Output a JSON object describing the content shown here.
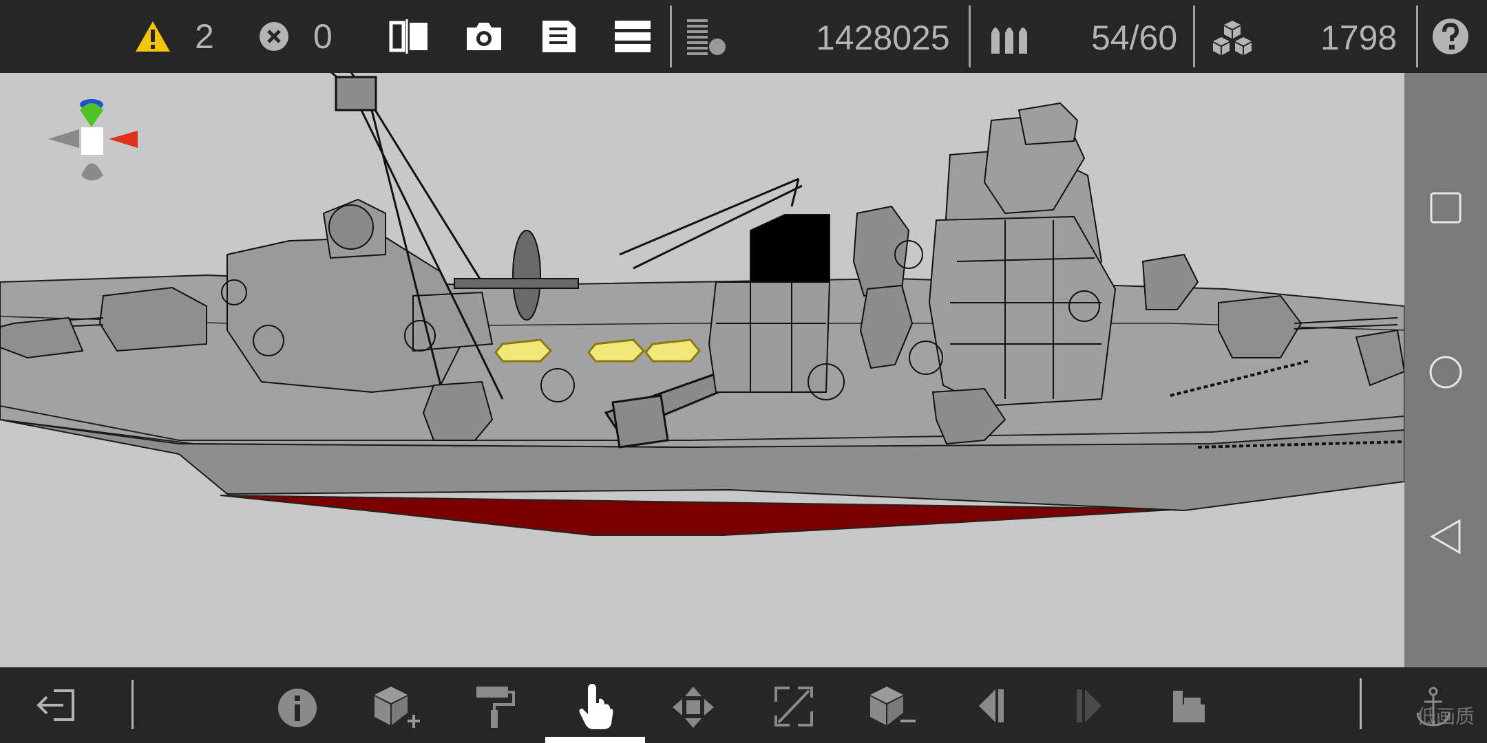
{
  "top_bar": {
    "warning_count": "2",
    "error_count": "0",
    "polygon_count": "1428025",
    "ammo": "54/60",
    "parts_count": "1798"
  },
  "bottom_bar": {
    "active_tool": "select-tool"
  },
  "watermark": "低画质",
  "colors": {
    "bar_bg": "#262626",
    "viewport_bg": "#c8c8c8",
    "warning_yellow": "#f5c400",
    "hull_red": "#7a0000",
    "selection_yellow": "#f2e87a",
    "axis_green": "#4fc226",
    "axis_red": "#e0301e",
    "axis_blue": "#2050d0"
  }
}
